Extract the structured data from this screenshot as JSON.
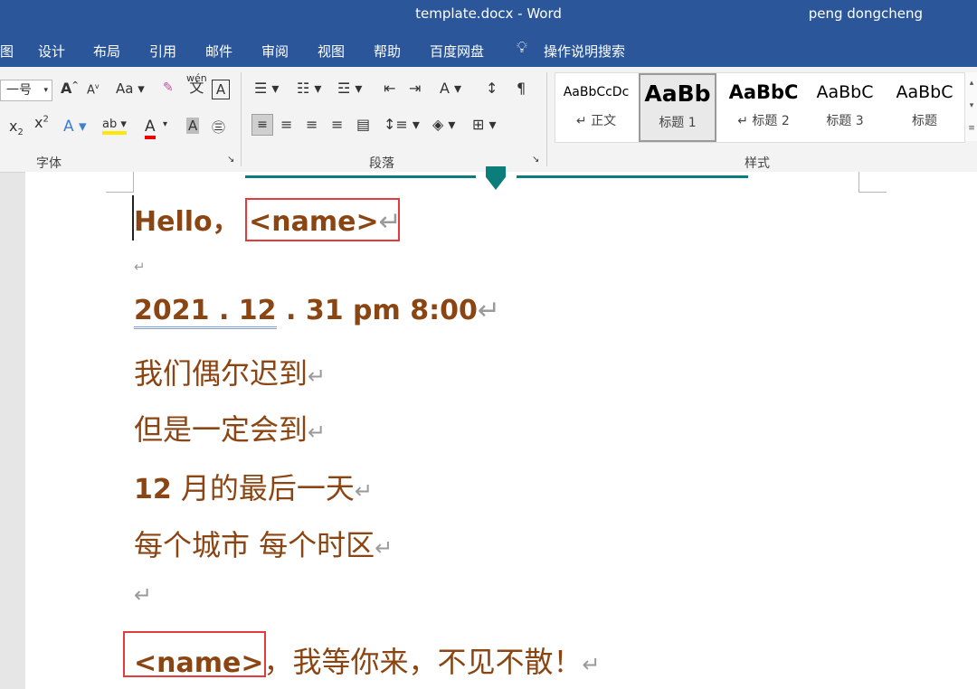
{
  "window": {
    "title": "template.docx  -  Word",
    "user": "peng dongcheng"
  },
  "tabs": [
    "图",
    "设计",
    "布局",
    "引用",
    "邮件",
    "审阅",
    "视图",
    "帮助",
    "百度网盘",
    "操作说明搜索"
  ],
  "ribbon": {
    "font_size": "一号",
    "group_font": "字体",
    "group_paragraph": "段落",
    "group_styles": "样式",
    "styles": [
      {
        "sample": "AaBbCcDc",
        "name": "正文"
      },
      {
        "sample": "AaBb",
        "name": "标题 1"
      },
      {
        "sample": "AaBbC",
        "name": "标题 2"
      },
      {
        "sample": "AaBbC",
        "name": "标题 3"
      },
      {
        "sample": "AaBbC",
        "name": "标题"
      }
    ]
  },
  "document": {
    "hello": "Hello，",
    "name_tag": "<name>",
    "date_a": "2021",
    "date_b": " . ",
    "date_c": "12",
    "date_d": " . 31 pm 8:00",
    "line1": "我们偶尔迟到",
    "line2": "但是一定会到",
    "line3_num": "12",
    "line3_text": " 月的最后一天",
    "line4": "每个城市 每个时区",
    "line5_text": "，我等你来，不见不散！",
    "para_mark": "↵"
  },
  "colors": {
    "accent": "#2b579a",
    "text": "#8b4513",
    "highlight_box": "#e23b3b"
  }
}
